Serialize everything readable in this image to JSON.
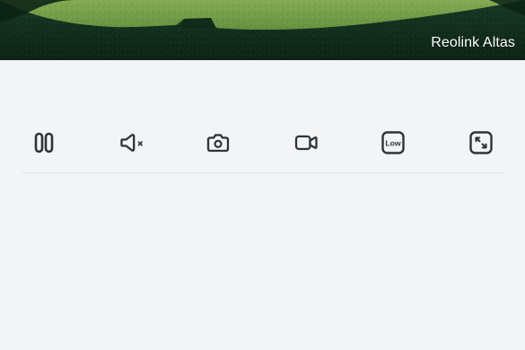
{
  "camera": {
    "name": "Reolink Altas"
  },
  "toolbar": {
    "buttons": [
      {
        "name": "pause",
        "icon": "pause-icon"
      },
      {
        "name": "mute",
        "icon": "speaker-muted-icon"
      },
      {
        "name": "snapshot",
        "icon": "camera-icon"
      },
      {
        "name": "record",
        "icon": "video-record-icon"
      },
      {
        "name": "quality",
        "icon": "quality-badge-icon",
        "label": "Low"
      },
      {
        "name": "fullscreen",
        "icon": "fullscreen-icon"
      }
    ]
  },
  "colors": {
    "icon": "#2f3238",
    "panel": "#f3f4f6",
    "divider": "#e1e3e8",
    "grass": "#5f8f3d",
    "shadow": "#0f2a1a"
  }
}
